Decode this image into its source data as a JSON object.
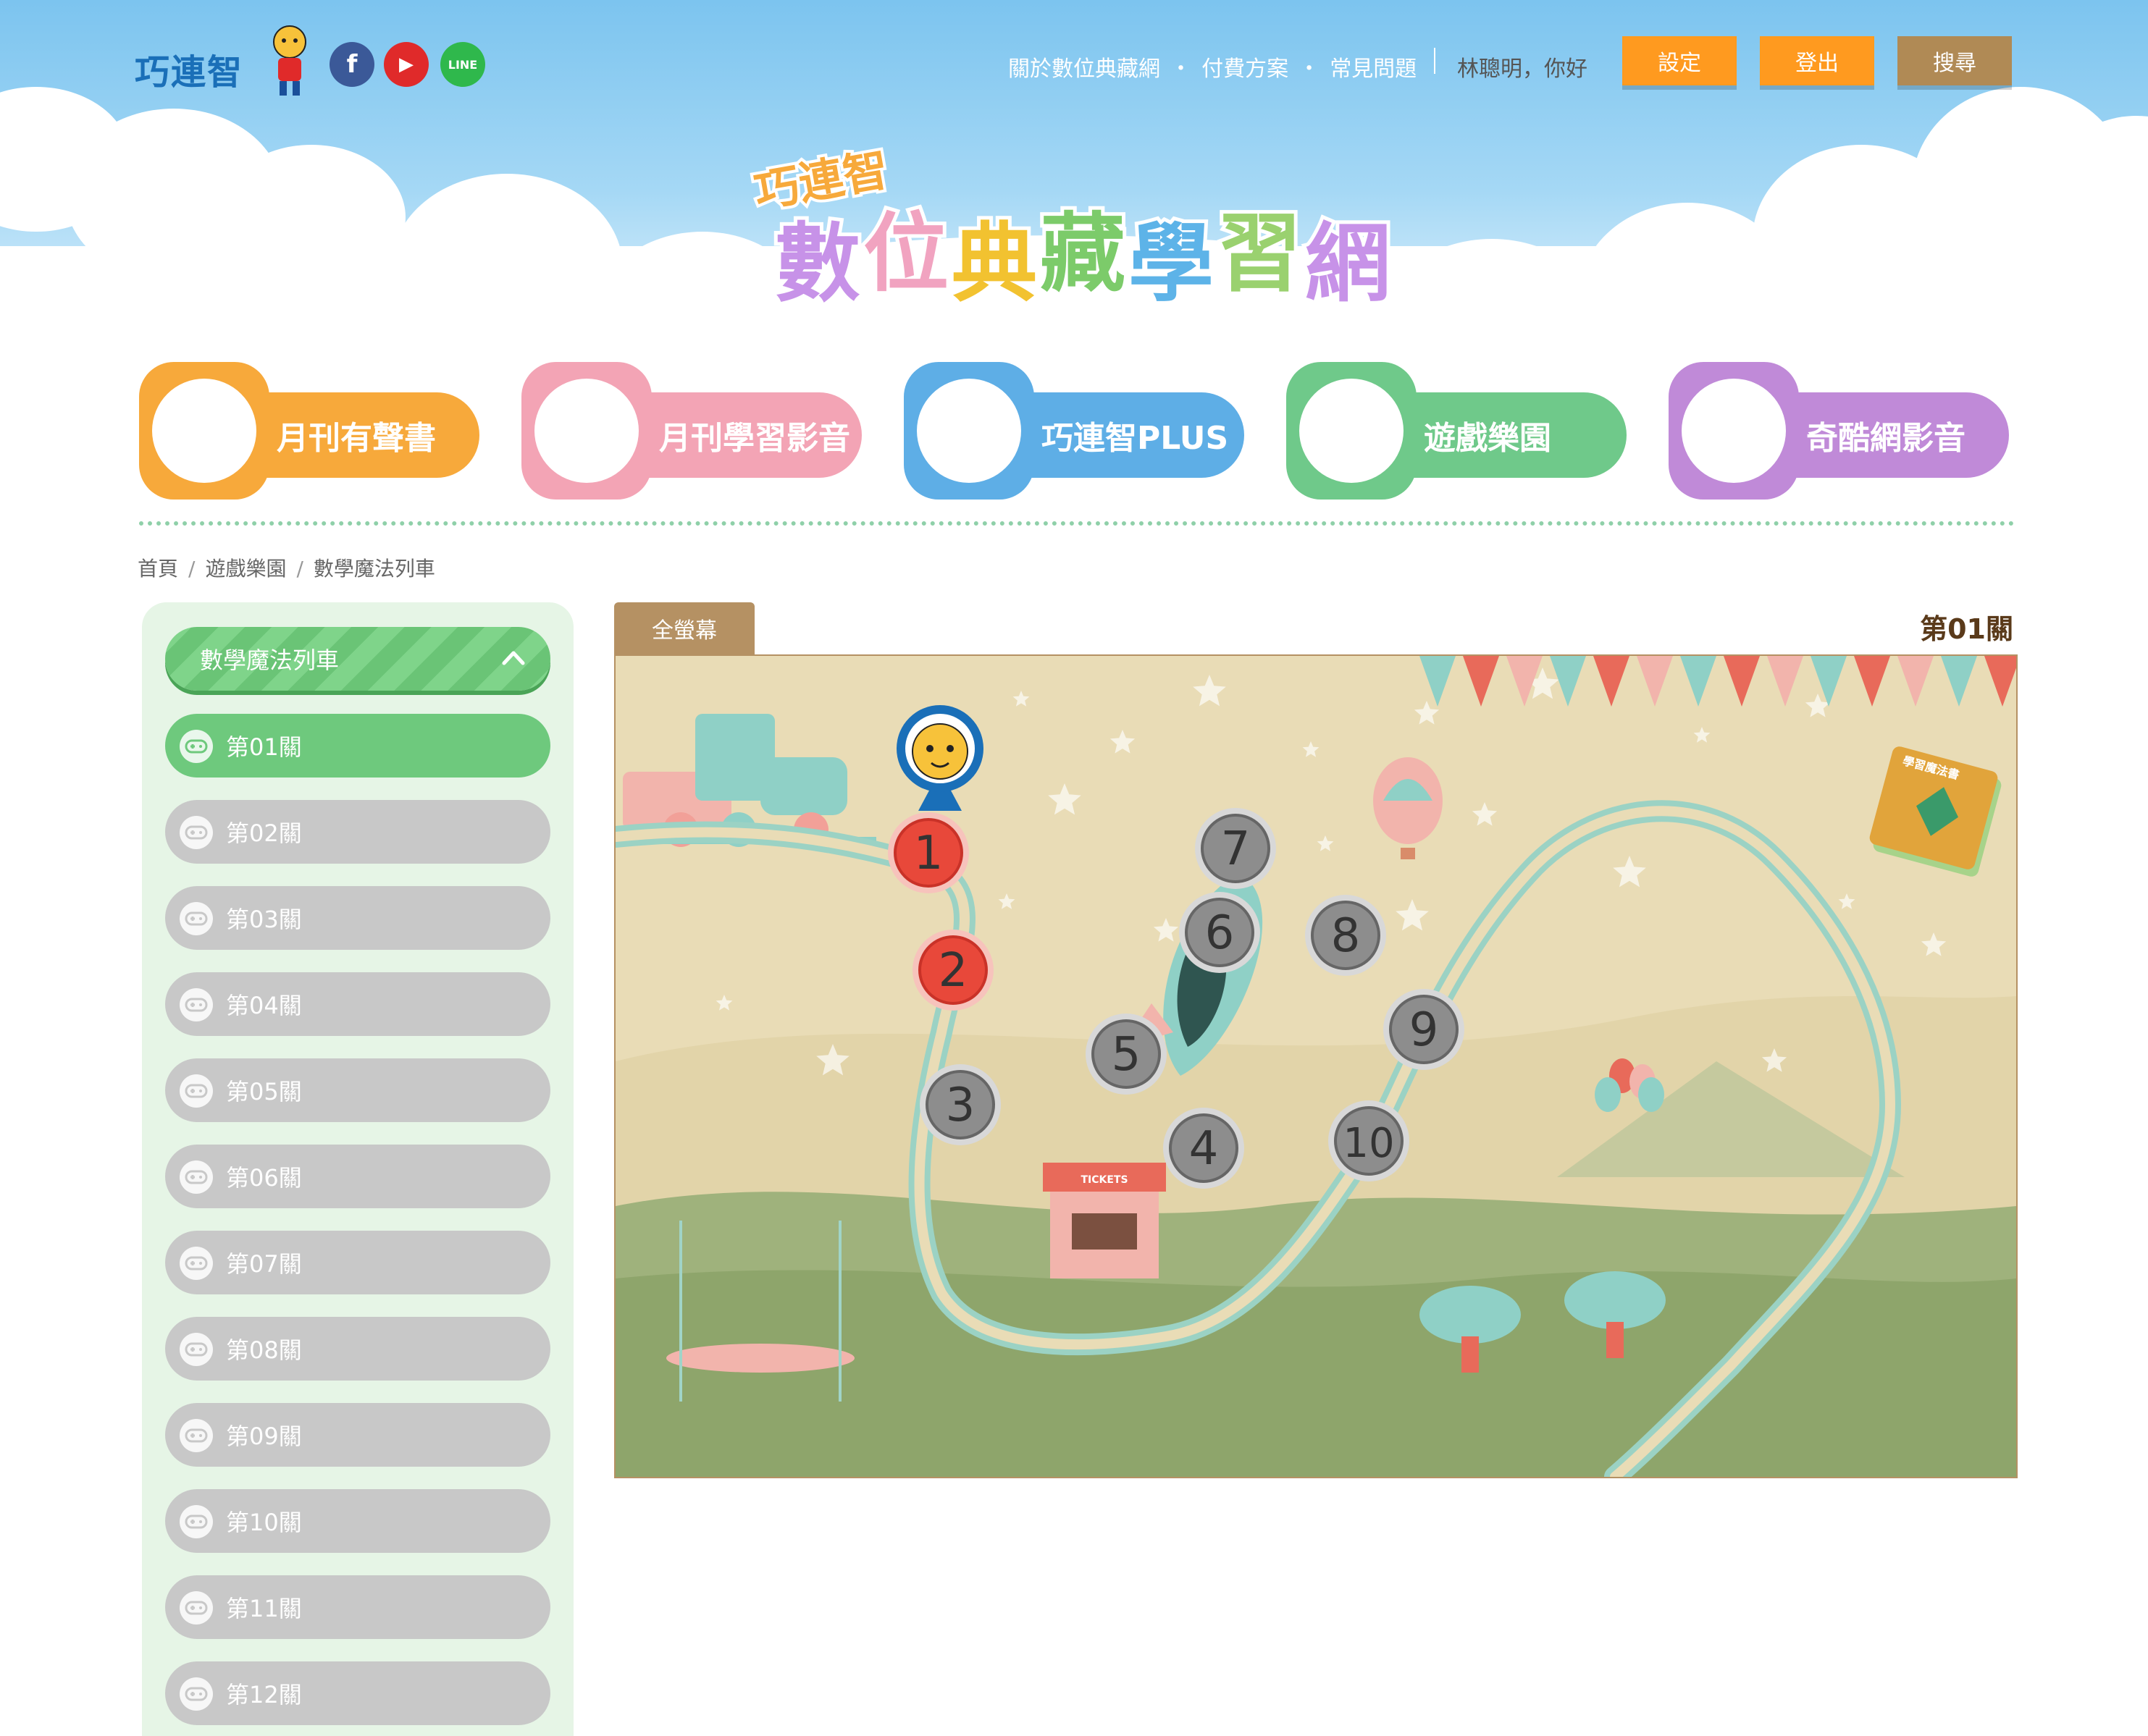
{
  "header": {
    "brand": "巧連智",
    "social": [
      {
        "name": "facebook",
        "glyph": "f",
        "color": "#3b5998"
      },
      {
        "name": "youtube",
        "glyph": "▶",
        "color": "#e02a2a"
      },
      {
        "name": "line",
        "glyph": "LINE",
        "color": "#2fb84c"
      }
    ],
    "links": [
      "關於數位典藏網",
      "付費方案",
      "常見問題"
    ],
    "greeting": "林聰明，你好",
    "buttons": {
      "settings": "設定",
      "logout": "登出",
      "search": "搜尋"
    },
    "logo_small": "巧連智",
    "logo_chars": [
      "數",
      "位",
      "典",
      "藏",
      "學",
      "習",
      "網"
    ],
    "logo_colors": [
      "#c792e8",
      "#f1a3c0",
      "#f2c230",
      "#7ccb6a",
      "#5db3e8",
      "#9ad16f",
      "#c792e8"
    ]
  },
  "categories": [
    {
      "label": "月刊有聲書",
      "color": "#f7a93b",
      "face": "tiger"
    },
    {
      "label": "月刊學習影音",
      "color": "#f3a4b5",
      "face": "rabbit"
    },
    {
      "label": "巧連智PLUS",
      "color": "#5eaee6",
      "face": "cat"
    },
    {
      "label": "遊戲樂園",
      "color": "#6fc98a",
      "face": "parrot"
    },
    {
      "label": "奇酷網影音",
      "color": "#c08ad8",
      "face": "chicken"
    }
  ],
  "breadcrumb": [
    "首頁",
    "遊戲樂園",
    "數學魔法列車"
  ],
  "sidebar": {
    "title": "數學魔法列車",
    "levels": [
      "第01關",
      "第02關",
      "第03關",
      "第04關",
      "第05關",
      "第06關",
      "第07關",
      "第08關",
      "第09關",
      "第10關",
      "第11關",
      "第12關"
    ],
    "active_index": 0
  },
  "game": {
    "fullscreen": "全螢幕",
    "current_level": "第01關",
    "book_label": "學習魔法書",
    "ticket_label": "TICKETS",
    "stations": [
      {
        "label": "1",
        "state": "unlocked"
      },
      {
        "label": "2",
        "state": "unlocked"
      },
      {
        "label": "3",
        "state": "locked"
      },
      {
        "label": "4",
        "state": "locked"
      },
      {
        "label": "5",
        "state": "locked"
      },
      {
        "label": "6",
        "state": "locked"
      },
      {
        "label": "7",
        "state": "locked"
      },
      {
        "label": "8",
        "state": "locked"
      },
      {
        "label": "9",
        "state": "locked"
      },
      {
        "label": "10",
        "state": "locked"
      }
    ]
  }
}
